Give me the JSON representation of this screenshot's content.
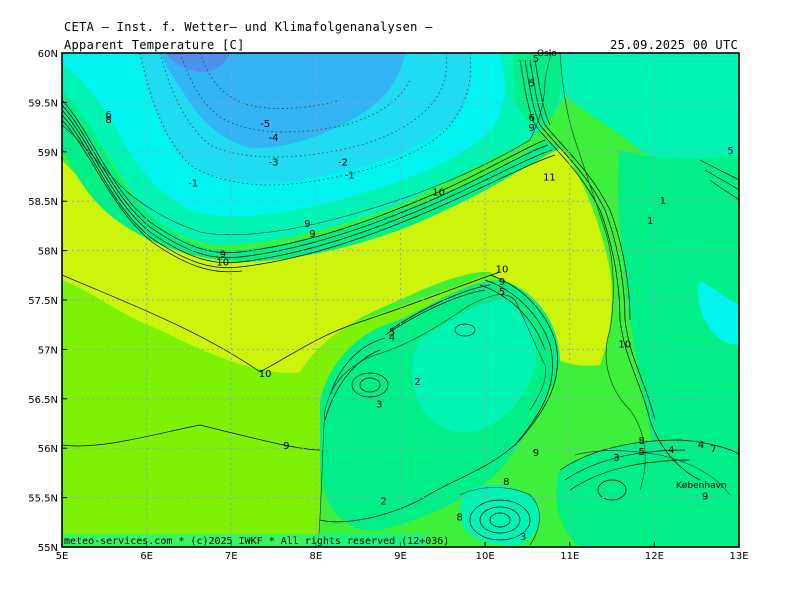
{
  "header": {
    "institution": "CETA — Inst. f. Wetter— und Klimafolgenanalysen —",
    "parameter": "Apparent Temperature [C]",
    "valid_time": "25.09.2025 00 UTC"
  },
  "footer": {
    "credit": "meteo-services.com * (c)2025 IWKF * All rights reserved (12+036)"
  },
  "axes": {
    "lon_ticks": [
      "5E",
      "6E",
      "7E",
      "8E",
      "9E",
      "10E",
      "11E",
      "12E",
      "13E"
    ],
    "lat_ticks": [
      "60N",
      "59.5N",
      "59N",
      "58.5N",
      "58N",
      "57.5N",
      "57N",
      "56.5N",
      "56N",
      "55.5N",
      "55N"
    ]
  },
  "places": [
    "Oslo",
    "København"
  ],
  "colors": {
    "deep_blue": "#4f8ff0",
    "blue": "#32b4f5",
    "light_blue": "#1edcf2",
    "cyan": "#00f5f0",
    "aqua": "#00f5b5",
    "green": "#00ef86",
    "bright_green": "#3cf03c",
    "lime": "#7ef205",
    "yellow_green": "#ccf50b",
    "gridline": "#9a9acd"
  },
  "contour_labels": [
    {
      "text": "-5",
      "lon": 7.4,
      "lat": 59.25
    },
    {
      "text": "-4",
      "lon": 7.5,
      "lat": 59.11
    },
    {
      "text": "-3",
      "lon": 7.5,
      "lat": 58.86
    },
    {
      "text": "-2",
      "lon": 8.32,
      "lat": 58.86
    },
    {
      "text": "-1",
      "lon": 8.4,
      "lat": 58.73
    },
    {
      "text": "-1",
      "lon": 6.55,
      "lat": 58.65
    },
    {
      "text": "6",
      "lon": 5.55,
      "lat": 59.34
    },
    {
      "text": "8",
      "lon": 5.55,
      "lat": 59.29
    },
    {
      "text": "9",
      "lon": 7.9,
      "lat": 58.24
    },
    {
      "text": "9",
      "lon": 7.96,
      "lat": 58.14
    },
    {
      "text": "10",
      "lon": 6.9,
      "lat": 57.85
    },
    {
      "text": "9",
      "lon": 6.9,
      "lat": 57.93
    },
    {
      "text": "10",
      "lon": 9.45,
      "lat": 58.56
    },
    {
      "text": "11",
      "lon": 10.76,
      "lat": 58.71
    },
    {
      "text": "1",
      "lon": 12.1,
      "lat": 58.47
    },
    {
      "text": "1",
      "lon": 11.95,
      "lat": 58.27
    },
    {
      "text": "5",
      "lon": 12.9,
      "lat": 58.98
    },
    {
      "text": "5",
      "lon": 10.6,
      "lat": 59.91
    },
    {
      "text": "5",
      "lon": 10.55,
      "lat": 59.66
    },
    {
      "text": "6",
      "lon": 10.55,
      "lat": 59.31
    },
    {
      "text": "9",
      "lon": 10.55,
      "lat": 59.21
    },
    {
      "text": "10",
      "lon": 10.2,
      "lat": 57.78
    },
    {
      "text": "9",
      "lon": 10.2,
      "lat": 57.65
    },
    {
      "text": "5",
      "lon": 10.2,
      "lat": 57.55
    },
    {
      "text": "5",
      "lon": 8.9,
      "lat": 57.14
    },
    {
      "text": "4",
      "lon": 8.9,
      "lat": 57.09
    },
    {
      "text": "10",
      "lon": 11.65,
      "lat": 57.02
    },
    {
      "text": "10",
      "lon": 7.4,
      "lat": 56.72
    },
    {
      "text": "2",
      "lon": 9.2,
      "lat": 56.64
    },
    {
      "text": "3",
      "lon": 8.75,
      "lat": 56.41
    },
    {
      "text": "9",
      "lon": 7.65,
      "lat": 55.99
    },
    {
      "text": "9",
      "lon": 10.6,
      "lat": 55.92
    },
    {
      "text": "3",
      "lon": 11.55,
      "lat": 55.87
    },
    {
      "text": "5",
      "lon": 11.85,
      "lat": 55.93
    },
    {
      "text": "8",
      "lon": 11.85,
      "lat": 56.04
    },
    {
      "text": "4",
      "lon": 12.2,
      "lat": 55.95
    },
    {
      "text": "4",
      "lon": 12.55,
      "lat": 56.0
    },
    {
      "text": "7",
      "lon": 12.7,
      "lat": 55.96
    },
    {
      "text": "8",
      "lon": 10.25,
      "lat": 55.63
    },
    {
      "text": "9",
      "lon": 12.6,
      "lat": 55.48
    },
    {
      "text": "2",
      "lon": 8.8,
      "lat": 55.43
    },
    {
      "text": "8",
      "lon": 9.7,
      "lat": 55.27
    },
    {
      "text": "3",
      "lon": 10.45,
      "lat": 55.07
    }
  ]
}
